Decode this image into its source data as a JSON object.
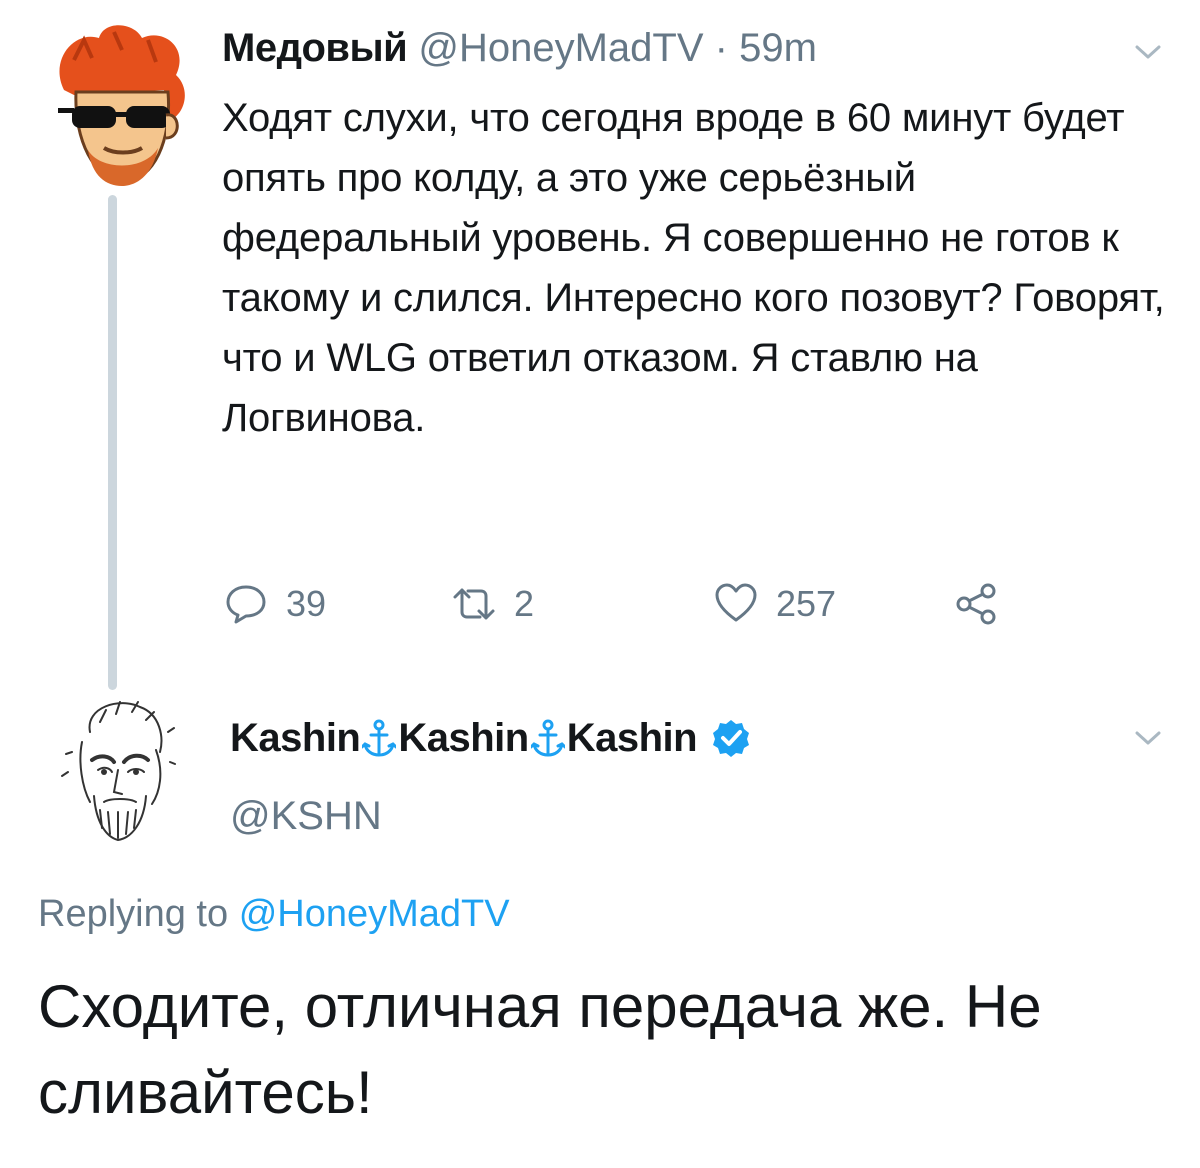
{
  "tweet1": {
    "avatar": "avatar-illustration-red-hair-sunglasses",
    "name": "Медовый",
    "handle": "@HoneyMadTV",
    "separator": "·",
    "time": "59m",
    "text": "Ходят слухи, что сегодня вроде в 60 минут будет опять про колду, а это уже серьёзный федеральный уровень. Я совершенно не готов к такому и слился. Интересно кого позовут? Говорят, что и WLG ответил отказом. Я ставлю на Логвинова.",
    "actions": {
      "reply_icon": "reply-icon",
      "reply_count": "39",
      "retweet_icon": "retweet-icon",
      "retweet_count": "2",
      "like_icon": "heart-icon",
      "like_count": "257",
      "share_icon": "share-icon"
    }
  },
  "tweet2": {
    "avatar": "avatar-sketch-bearded-man",
    "name_parts": [
      "Kashin",
      "Kashin",
      "Kashin"
    ],
    "name_separator_icon": "anchor-icon",
    "verified_icon": "verified-badge-icon",
    "handle": "@KSHN",
    "replying_prefix": "Replying to",
    "replying_to": "@HoneyMadTV",
    "text": "Сходите, отличная передача же. Не сливайтесь!"
  },
  "colors": {
    "text": "#14171a",
    "secondary": "#657786",
    "link": "#1da1f2",
    "thread_line": "#ccd6dd",
    "anchor": "#1da1f2"
  }
}
